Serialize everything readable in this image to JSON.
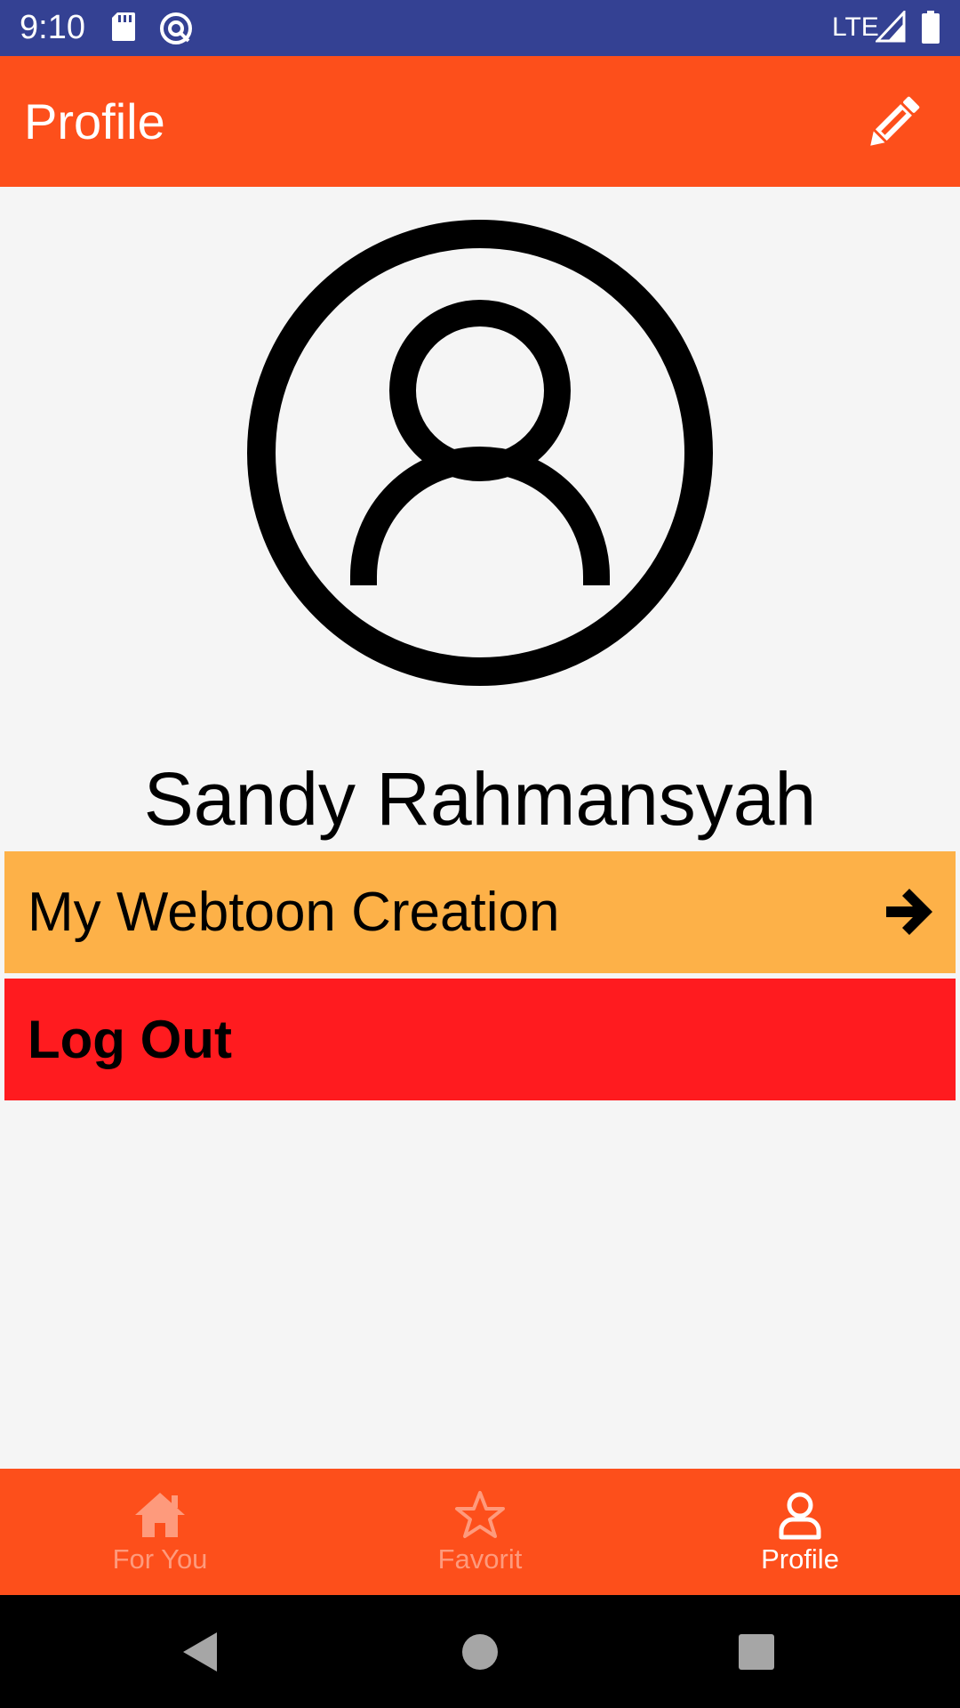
{
  "status_bar": {
    "time": "9:10",
    "network": "LTE",
    "icons": [
      "sd-card-icon",
      "sync-icon",
      "signal-icon",
      "battery-icon"
    ]
  },
  "app_bar": {
    "title": "Profile",
    "action_icon": "pencil-icon"
  },
  "profile": {
    "avatar_icon": "user-circle-icon",
    "name": "Sandy Rahmansyah"
  },
  "menu": {
    "creation_label": "My Webtoon Creation",
    "creation_icon": "arrow-right-icon",
    "logout_label": "Log Out"
  },
  "bottom_nav": {
    "items": [
      {
        "label": "For You",
        "icon": "home-icon",
        "active": false
      },
      {
        "label": "Favorit",
        "icon": "star-icon",
        "active": false
      },
      {
        "label": "Profile",
        "icon": "user-icon",
        "active": true
      }
    ]
  },
  "system_nav": {
    "icons": [
      "back-icon",
      "home-circle-icon",
      "recents-icon"
    ]
  },
  "colors": {
    "status_bar": "#344193",
    "accent": "#fd4f1b",
    "creation_button": "#fdb148",
    "logout_button": "#ff1b1f",
    "background": "#f5f5f5",
    "nav_inactive": "#fe9a7c",
    "nav_active": "#ffffff"
  }
}
